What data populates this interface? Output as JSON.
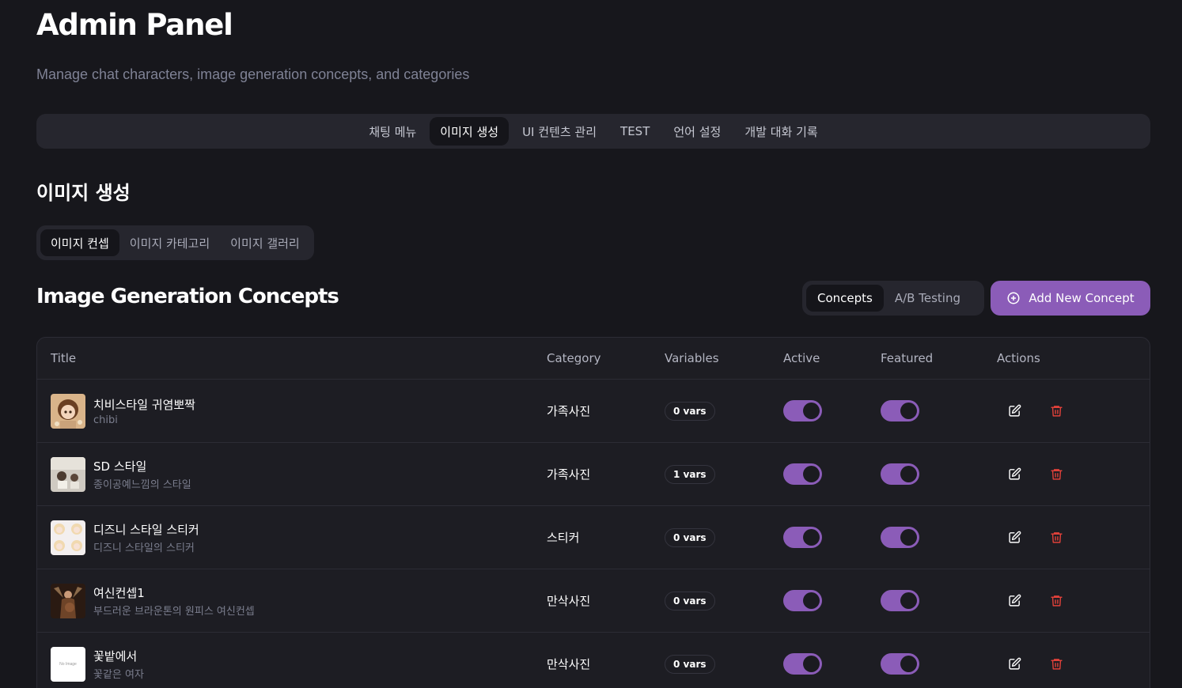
{
  "header": {
    "title": "Admin Panel",
    "subtitle": "Manage chat characters, image generation concepts, and categories"
  },
  "main_nav": {
    "tabs": [
      {
        "label": "채팅 메뉴",
        "active": false
      },
      {
        "label": "이미지 생성",
        "active": true
      },
      {
        "label": "UI 컨텐츠 관리",
        "active": false
      },
      {
        "label": "TEST",
        "active": false
      },
      {
        "label": "언어 설정",
        "active": false
      },
      {
        "label": "개발 대화 기록",
        "active": false
      }
    ]
  },
  "section": {
    "title": "이미지 생성",
    "sub_tabs": [
      {
        "label": "이미지 컨셉",
        "active": true
      },
      {
        "label": "이미지 카테고리",
        "active": false
      },
      {
        "label": "이미지 갤러리",
        "active": false
      }
    ]
  },
  "concepts": {
    "heading": "Image Generation Concepts",
    "view_toggle": [
      {
        "label": "Concepts",
        "active": true
      },
      {
        "label": "A/B Testing",
        "active": false
      }
    ],
    "add_button_label": "Add New Concept",
    "add_icon": "plus-circle-icon"
  },
  "table": {
    "columns": [
      "Title",
      "Category",
      "Variables",
      "Active",
      "Featured",
      "Actions"
    ],
    "rows": [
      {
        "title": "치비스타일 귀염뽀짝",
        "subtitle": "chibi",
        "category": "가족사진",
        "vars": "0 vars",
        "active": true,
        "featured": true,
        "thumb": "chibi"
      },
      {
        "title": "SD 스타일",
        "subtitle": "종이공예느낌의 스타일",
        "category": "가족사진",
        "vars": "1 vars",
        "active": true,
        "featured": true,
        "thumb": "photo"
      },
      {
        "title": "디즈니 스타일 스티커",
        "subtitle": "디즈니 스타일의 스티커",
        "category": "스티커",
        "vars": "0 vars",
        "active": true,
        "featured": true,
        "thumb": "sticker"
      },
      {
        "title": "여신컨셉1",
        "subtitle": "부드러운 브라운톤의 원피스 여신컨셉",
        "category": "만삭사진",
        "vars": "0 vars",
        "active": true,
        "featured": true,
        "thumb": "goddess"
      },
      {
        "title": "꽃밭에서",
        "subtitle": "꽃같은 여자",
        "category": "만삭사진",
        "vars": "0 vars",
        "active": true,
        "featured": true,
        "thumb": "none",
        "no_image_label": "No Image"
      }
    ],
    "edit_icon": "edit-icon",
    "delete_icon": "trash-icon"
  },
  "colors": {
    "background": "#17171c",
    "accent": "#8b5cb8",
    "danger": "#e0413a"
  }
}
